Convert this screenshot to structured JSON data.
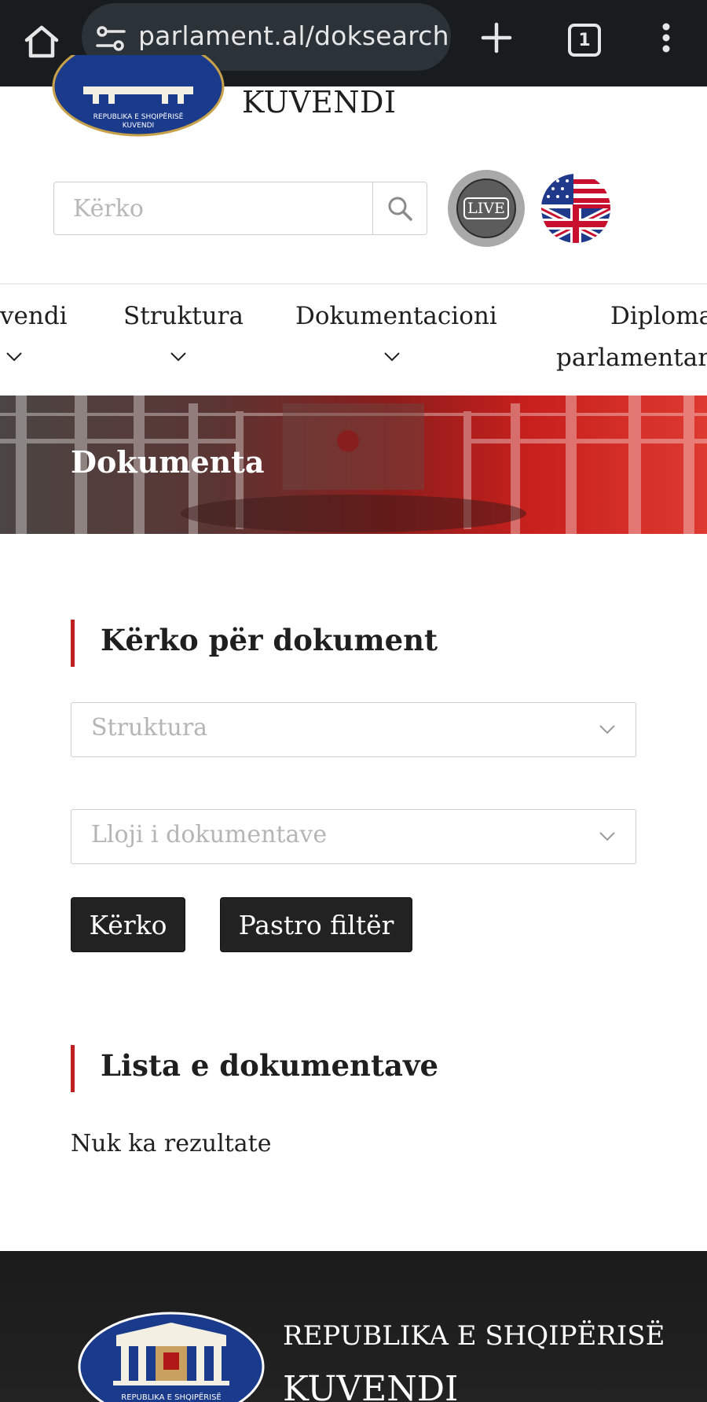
{
  "browser": {
    "url": "parlament.al/doksearch",
    "tab_count": "1",
    "icons": [
      "home-icon",
      "site-settings-icon",
      "new-tab-icon",
      "tabs-icon",
      "more-icon"
    ]
  },
  "header": {
    "logo_text": "REPUBLIKA E SHQIPËRISË",
    "logo_subtext": "KUVENDI",
    "site_name": "KUVENDI",
    "search_placeholder": "Kërko",
    "live_label": "LIVE"
  },
  "nav": {
    "items": [
      {
        "label": "Kuvendi",
        "visible_label": "vendi"
      },
      {
        "label": "Struktura"
      },
      {
        "label": "Dokumentacioni"
      },
      {
        "label_line1": "Diplomacia",
        "visible_line1": "Diploma",
        "label_line2": "parlamentare",
        "visible_line2": "parlamentare"
      }
    ]
  },
  "banner": {
    "title": "Dokumenta"
  },
  "search_section": {
    "title": "Kërko për dokument",
    "structure_placeholder": "Struktura",
    "type_placeholder": "Lloji i dokumentave",
    "search_button": "Kërko",
    "clear_button": "Pastro filtër"
  },
  "results_section": {
    "title": "Lista e dokumentave",
    "empty_text": "Nuk ka rezultate"
  },
  "footer": {
    "line1": "REPUBLIKA E SHQIPËRISË",
    "line2": "KUVENDI",
    "logo_text": "REPUBLIKA E SHQIPËRISË"
  },
  "colors": {
    "accent": "#c0201f",
    "chrome_bg": "#181c1f",
    "button_bg": "#222222",
    "footer_bg": "#1b1b1b"
  }
}
